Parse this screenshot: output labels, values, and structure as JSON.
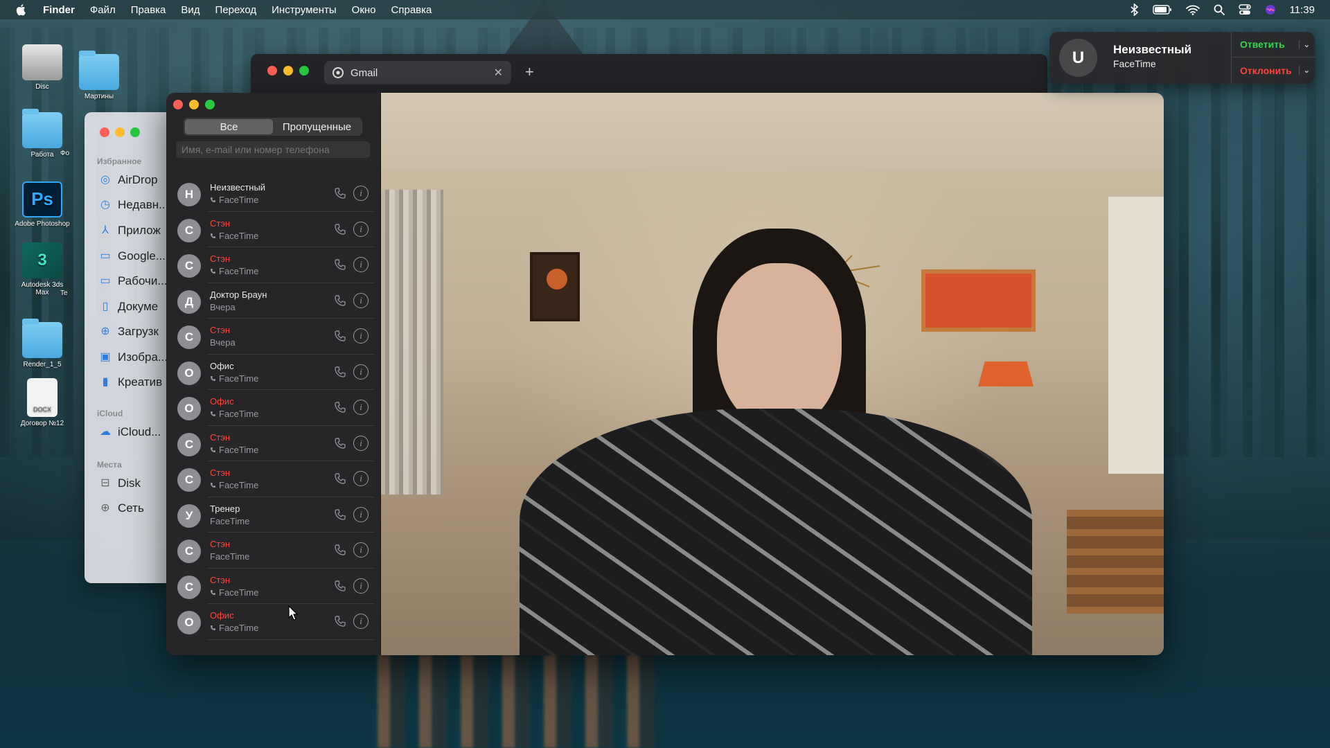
{
  "menubar": {
    "items": [
      "Finder",
      "Файл",
      "Правка",
      "Вид",
      "Переход",
      "Инструменты",
      "Окно",
      "Справка"
    ],
    "clock": "11:39",
    "status_icons": [
      "bluetooth-icon",
      "battery-icon",
      "wifi-icon",
      "search-icon",
      "control-center-icon",
      "siri-icon"
    ]
  },
  "desktop": {
    "icons": [
      {
        "label": "Disc",
        "icon": "disk-icon"
      },
      {
        "label": "Мартины",
        "icon": "folder-icon"
      },
      {
        "label": "Работа",
        "icon": "folder-icon"
      },
      {
        "label": "Adobe Photoshop",
        "icon": "photoshop-icon"
      },
      {
        "label": "Autodesk 3ds Max",
        "icon": "3dsmax-icon"
      },
      {
        "label": "Render_1_5",
        "icon": "folder-icon"
      },
      {
        "label": "Договор №12",
        "icon": "docx-icon"
      }
    ],
    "partial_labels": [
      "Фо",
      "Te"
    ]
  },
  "finder": {
    "section_favorites": "Избранное",
    "favorites": [
      {
        "label": "AirDrop",
        "icon": "airdrop-icon"
      },
      {
        "label": "Недавн...",
        "icon": "clock-icon"
      },
      {
        "label": "Прилож",
        "icon": "apps-icon"
      },
      {
        "label": "Google...",
        "icon": "folder-icon"
      },
      {
        "label": "Рабочи...",
        "icon": "desktop-icon"
      },
      {
        "label": "Докуме",
        "icon": "document-icon"
      },
      {
        "label": "Загрузк",
        "icon": "download-icon"
      },
      {
        "label": "Изобра...",
        "icon": "image-icon"
      },
      {
        "label": "Креатив",
        "icon": "file-icon"
      }
    ],
    "section_icloud": "iCloud",
    "icloud": [
      {
        "label": "iCloud...",
        "icon": "cloud-icon"
      }
    ],
    "section_places": "Места",
    "places": [
      {
        "label": "Disk",
        "icon": "drive-icon"
      },
      {
        "label": "Сеть",
        "icon": "network-icon"
      }
    ]
  },
  "browser": {
    "tab_title": "Gmail",
    "new_tab": "+"
  },
  "facetime": {
    "filter": {
      "all": "Все",
      "missed": "Пропущенные",
      "selected": "all"
    },
    "search_placeholder": "Имя, e-mail или номер телефона",
    "calls": [
      {
        "initial": "Н",
        "name": "Неизвестный",
        "detail": "FaceTime",
        "missed": false,
        "phone_glyph": true
      },
      {
        "initial": "С",
        "name": "Стэн",
        "detail": "FaceTime",
        "missed": true,
        "phone_glyph": true
      },
      {
        "initial": "С",
        "name": "Стэн",
        "detail": "FaceTime",
        "missed": true,
        "phone_glyph": true
      },
      {
        "initial": "Д",
        "name": "Доктор Браун",
        "detail": "Вчера",
        "missed": false,
        "phone_glyph": false
      },
      {
        "initial": "С",
        "name": "Стэн",
        "detail": "Вчера",
        "missed": true,
        "phone_glyph": false
      },
      {
        "initial": "О",
        "name": "Офис",
        "detail": "FaceTime",
        "missed": false,
        "phone_glyph": true
      },
      {
        "initial": "О",
        "name": "Офис",
        "detail": "FaceTime",
        "missed": true,
        "phone_glyph": true
      },
      {
        "initial": "С",
        "name": "Стэн",
        "detail": "FaceTime",
        "missed": true,
        "phone_glyph": true
      },
      {
        "initial": "С",
        "name": "Стэн",
        "detail": "FaceTime",
        "missed": true,
        "phone_glyph": true
      },
      {
        "initial": "У",
        "name": "Тренер",
        "detail": "FaceTime",
        "missed": false,
        "phone_glyph": false
      },
      {
        "initial": "С",
        "name": "Стэн",
        "detail": "FaceTime",
        "missed": true,
        "phone_glyph": false
      },
      {
        "initial": "С",
        "name": "Стэн",
        "detail": "FaceTime",
        "missed": true,
        "phone_glyph": true
      },
      {
        "initial": "О",
        "name": "Офис",
        "detail": "FaceTime",
        "missed": true,
        "phone_glyph": true
      }
    ]
  },
  "notification": {
    "initial": "U",
    "title": "Неизвестный",
    "subtitle": "FaceTime",
    "answer": "Ответить",
    "decline": "Отклонить"
  },
  "colors": {
    "missed": "#ff453a",
    "answer": "#32d74b",
    "decline": "#ff453a"
  }
}
